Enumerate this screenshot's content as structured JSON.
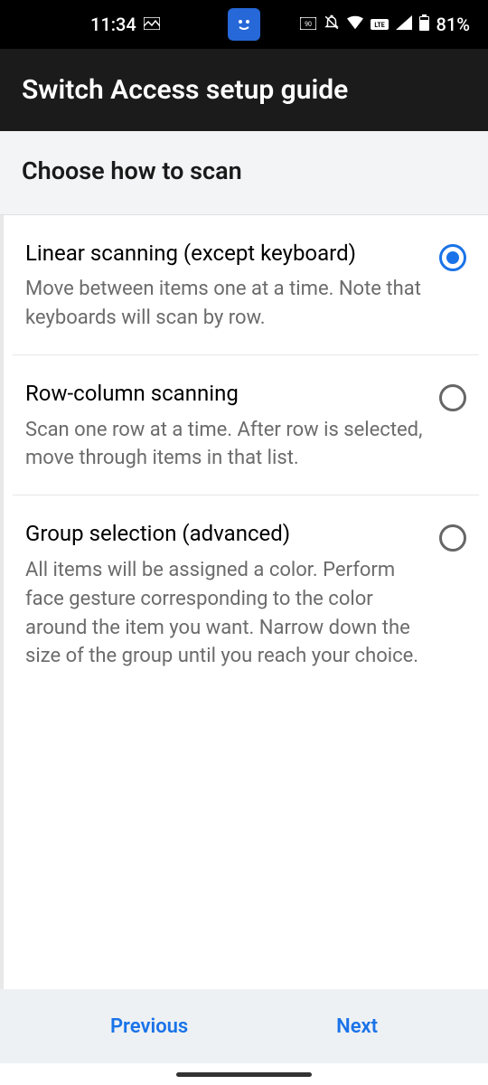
{
  "status": {
    "time": "11:34",
    "battery": "81%"
  },
  "header": {
    "title": "Switch Access setup guide"
  },
  "subheader": {
    "title": "Choose how to scan"
  },
  "options": [
    {
      "title": "Linear scanning (except keyboard)",
      "description": "Move between items one at a time. Note that keyboards will scan by row.",
      "selected": true
    },
    {
      "title": "Row-column scanning",
      "description": "Scan one row at a time. After row is selected, move through items in that list.",
      "selected": false
    },
    {
      "title": "Group selection (advanced)",
      "description": "All items will be assigned a color. Perform face gesture corresponding to the color around the item you want. Narrow down the size of the group until you reach your choice.",
      "selected": false
    }
  ],
  "footer": {
    "previous": "Previous",
    "next": "Next"
  }
}
